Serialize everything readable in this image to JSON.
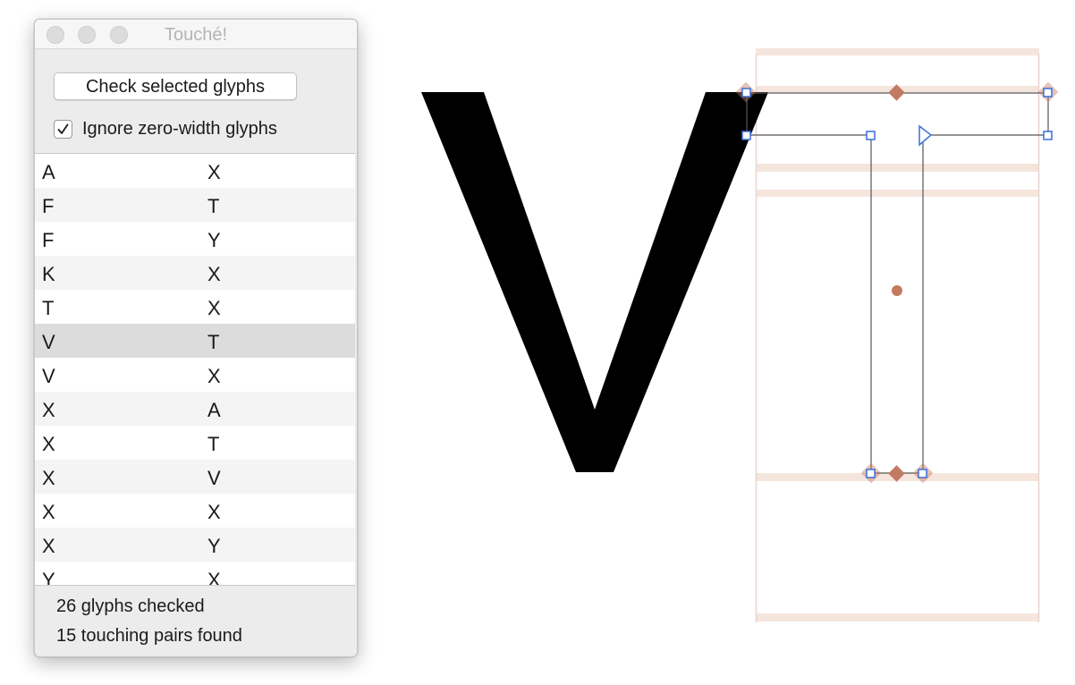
{
  "window": {
    "title": "Touché!",
    "check_button_label": "Check selected glyphs",
    "ignore_zero_width": {
      "label": "Ignore zero-width glyphs",
      "checked": true
    },
    "pairs": [
      {
        "left": "A",
        "right": "X"
      },
      {
        "left": "F",
        "right": "T"
      },
      {
        "left": "F",
        "right": "Y"
      },
      {
        "left": "K",
        "right": "X"
      },
      {
        "left": "T",
        "right": "X"
      },
      {
        "left": "V",
        "right": "T",
        "selected": true
      },
      {
        "left": "V",
        "right": "X"
      },
      {
        "left": "X",
        "right": "A"
      },
      {
        "left": "X",
        "right": "T"
      },
      {
        "left": "X",
        "right": "V"
      },
      {
        "left": "X",
        "right": "X"
      },
      {
        "left": "X",
        "right": "Y"
      },
      {
        "left": "Y",
        "right": "X"
      }
    ],
    "status": {
      "glyphs_checked": "26 glyphs checked",
      "pairs_found": "15 touching pairs found"
    }
  },
  "canvas": {
    "preview_glyph": "V",
    "edited_glyph": "T",
    "colors": {
      "glyph_fill": "#000000",
      "outline": "#555555",
      "oncurve_node": "#3a6fd8",
      "anchor": "#c27a62",
      "metrics_line": "#f5e6dd",
      "bounds_line": "#e8d5cc",
      "row_selected": "#dcdcdc",
      "row_alternate": "#f4f4f4"
    }
  }
}
